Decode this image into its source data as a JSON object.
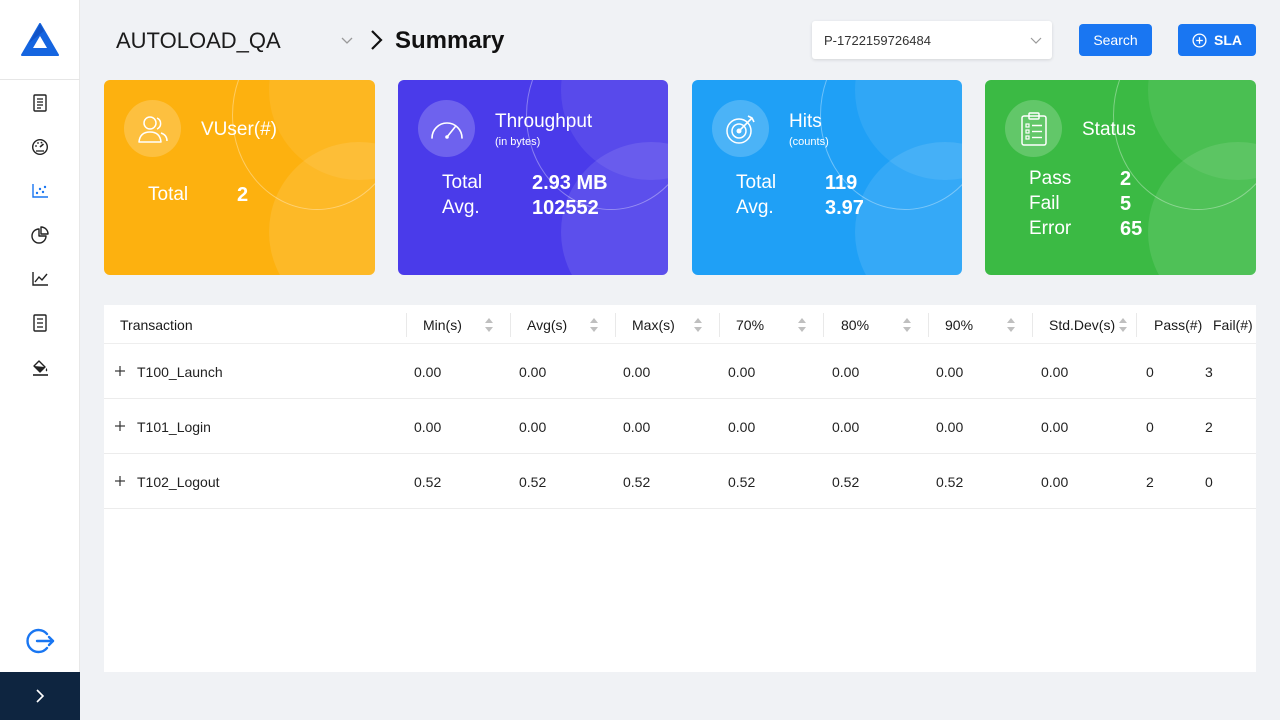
{
  "header": {
    "project": "AUTOLOAD_QA",
    "page_title": "Summary",
    "run_id": "P-1722159726484",
    "search_label": "Search",
    "sla_label": "SLA"
  },
  "sidebar": {
    "items": [
      {
        "icon": "report-icon"
      },
      {
        "icon": "dashboard-gauge-icon"
      },
      {
        "icon": "scatter-chart-icon"
      },
      {
        "icon": "pie-chart-icon"
      },
      {
        "icon": "line-chart-icon"
      },
      {
        "icon": "document-list-icon"
      },
      {
        "icon": "paint-bucket-icon"
      }
    ],
    "logout_icon": "logout-icon",
    "expand_icon": "chevron-right-icon"
  },
  "cards": {
    "vuser": {
      "title": "VUser(#)",
      "total_label": "Total",
      "total": "2"
    },
    "throughput": {
      "title": "Throughput",
      "subtitle": "(in bytes)",
      "total_label": "Total",
      "total": "2.93 MB",
      "avg_label": "Avg.",
      "avg": "102552"
    },
    "hits": {
      "title": "Hits",
      "subtitle": "(counts)",
      "total_label": "Total",
      "total": "119",
      "avg_label": "Avg.",
      "avg": "3.97"
    },
    "status": {
      "title": "Status",
      "pass_label": "Pass",
      "pass": "2",
      "fail_label": "Fail",
      "fail": "5",
      "error_label": "Error",
      "error": "65"
    }
  },
  "colors": {
    "vuser": "#fdb10f",
    "throughput": "#4a3bea",
    "hits": "#1fa0f6",
    "status": "#3bba44",
    "accent": "#1976f2",
    "sidebar_bottom": "#0e2540"
  },
  "table": {
    "columns": [
      "Transaction",
      "Min(s)",
      "Avg(s)",
      "Max(s)",
      "70%",
      "80%",
      "90%",
      "Std.Dev(s)",
      "Pass(#)",
      "Fail(#)"
    ],
    "rows": [
      {
        "name": "T100_Launch",
        "min": "0.00",
        "avg": "0.00",
        "max": "0.00",
        "p70": "0.00",
        "p80": "0.00",
        "p90": "0.00",
        "std": "0.00",
        "pass": "0",
        "fail": "3"
      },
      {
        "name": "T101_Login",
        "min": "0.00",
        "avg": "0.00",
        "max": "0.00",
        "p70": "0.00",
        "p80": "0.00",
        "p90": "0.00",
        "std": "0.00",
        "pass": "0",
        "fail": "2"
      },
      {
        "name": "T102_Logout",
        "min": "0.52",
        "avg": "0.52",
        "max": "0.52",
        "p70": "0.52",
        "p80": "0.52",
        "p90": "0.52",
        "std": "0.00",
        "pass": "2",
        "fail": "0"
      }
    ]
  }
}
